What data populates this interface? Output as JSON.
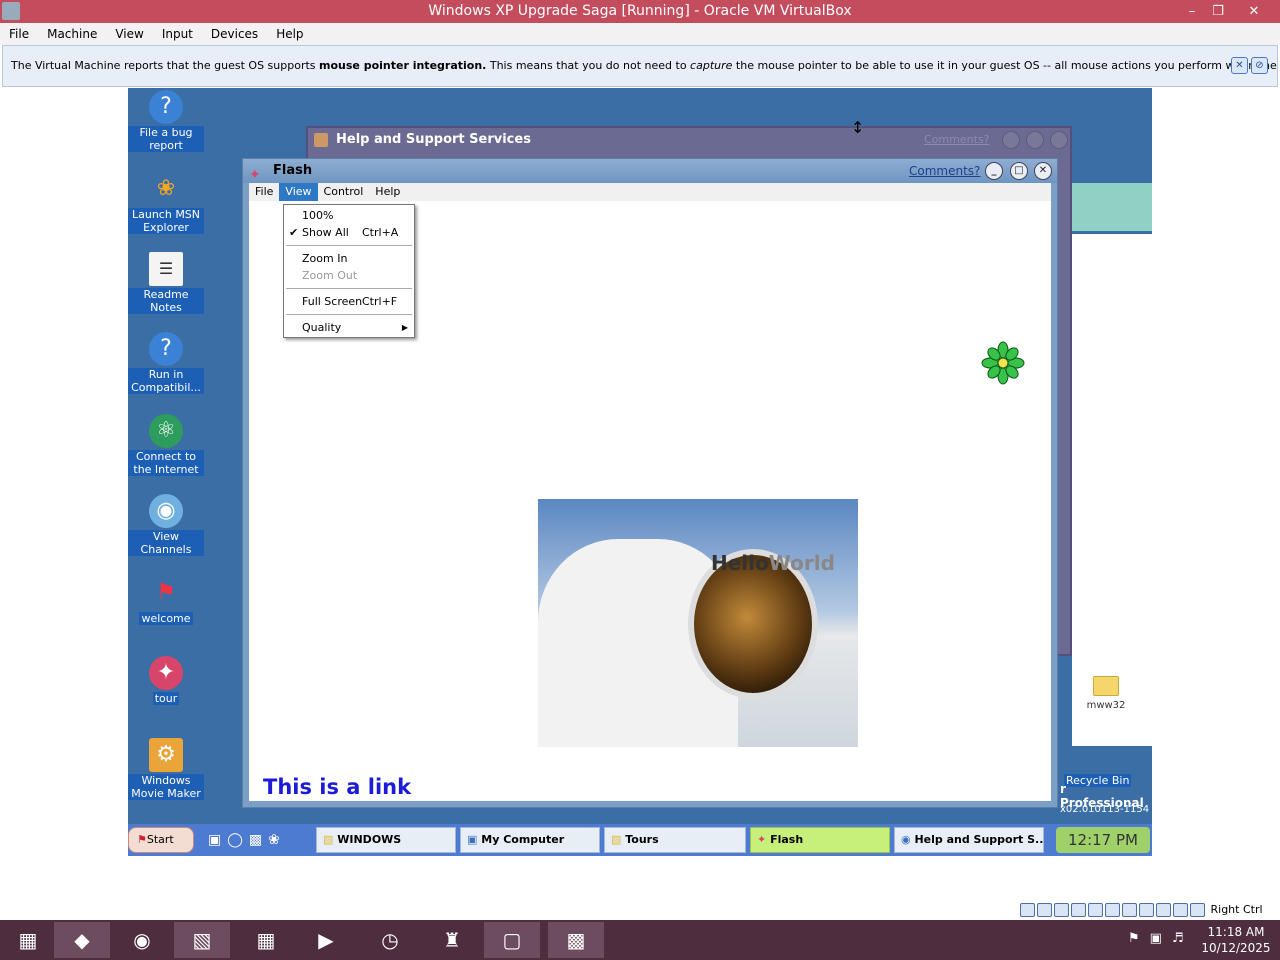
{
  "host": {
    "title": "Windows XP Upgrade Saga [Running] - Oracle VM VirtualBox",
    "menu": [
      "File",
      "Machine",
      "View",
      "Input",
      "Devices",
      "Help"
    ],
    "notice": {
      "part1": "The Virtual Machine reports that the guest OS supports ",
      "bold": "mouse pointer integration.",
      "part2": " This means that you do not need to ",
      "italic": "capture",
      "part3": " the mouse pointer to be able to use it in your guest OS -- all mouse actions you perform when the mouse pointer is over"
    },
    "status_text": "Right Ctrl",
    "clock_time": "11:18 AM",
    "clock_date": "10/12/2025"
  },
  "desktop_icons": [
    {
      "label": "File a bug report",
      "icon": "help-icon"
    },
    {
      "label": "Launch MSN Explorer",
      "icon": "msn-butterfly-icon"
    },
    {
      "label": "Readme Notes",
      "icon": "notes-icon"
    },
    {
      "label": "Run in Compatibil...",
      "icon": "help-icon"
    },
    {
      "label": "Connect to the Internet",
      "icon": "connect-icon"
    },
    {
      "label": "View Channels",
      "icon": "channels-icon"
    },
    {
      "label": "welcome",
      "icon": "windows-flag-icon"
    },
    {
      "label": "tour",
      "icon": "tour-icon"
    },
    {
      "label": "Windows Movie Maker",
      "icon": "movie-maker-icon"
    }
  ],
  "right_icons": {
    "folder_label": "mww32",
    "recycle_label": "Recycle Bin",
    "edition_label": "r Professional",
    "build_label": "x02.010113-1154"
  },
  "help_window": {
    "title": "Help and Support Services",
    "comments": "Comments?"
  },
  "flash_window": {
    "title": "Flash",
    "comments": "Comments?",
    "menu": [
      "File",
      "View",
      "Control",
      "Help"
    ],
    "link_text": "This is a link",
    "image_text_a": "Hello",
    "image_text_b": "World"
  },
  "view_menu": [
    {
      "label": "100%",
      "shortcut": "",
      "checked": false,
      "disabled": false
    },
    {
      "label": "Show All",
      "shortcut": "Ctrl+A",
      "checked": true,
      "disabled": false
    },
    {
      "label": "Zoom In",
      "shortcut": "",
      "checked": false,
      "disabled": false
    },
    {
      "label": "Zoom Out",
      "shortcut": "",
      "checked": false,
      "disabled": true
    },
    {
      "label": "Full Screen",
      "shortcut": "Ctrl+F",
      "checked": false,
      "disabled": false
    },
    {
      "label": "Quality",
      "shortcut": "",
      "checked": false,
      "disabled": false
    }
  ],
  "guest_taskbar": {
    "start": "Start",
    "items": [
      "WINDOWS",
      "My Computer",
      "Tours",
      "Flash",
      "Help and Support S..."
    ],
    "clock": "12:17 PM"
  },
  "colors": {
    "host_title": "#c44d5d",
    "guest_desktop": "#3a6ea5",
    "host_taskbar": "#4d2d3e"
  }
}
